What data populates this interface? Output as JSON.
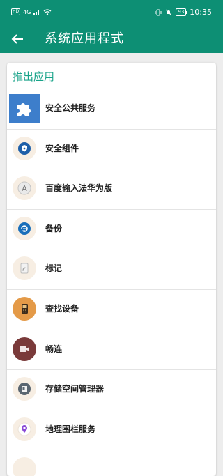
{
  "status": {
    "time": "10:35",
    "battery": "93",
    "hd": "HD",
    "signal": "4G"
  },
  "appbar": {
    "title": "系统应用程式"
  },
  "section": {
    "title": "推出应用"
  },
  "apps": [
    {
      "label": "安全公共服务",
      "icon": "puzzle-icon",
      "color": "#3d7ecb"
    },
    {
      "label": "安全组件",
      "icon": "shield-icon",
      "color": "#1e5fa8"
    },
    {
      "label": "百度输入法华为版",
      "icon": "keyboard-a-icon",
      "color": "#8c8c8c"
    },
    {
      "label": "备份",
      "icon": "backup-icon",
      "color": "#1a6fba"
    },
    {
      "label": "标记",
      "icon": "nfc-tag-icon",
      "color": "#b0b0b0"
    },
    {
      "label": "查找设备",
      "icon": "phone-finder-icon",
      "color": "#e49a48"
    },
    {
      "label": "畅连",
      "icon": "video-call-icon",
      "color": "#7a3a3a"
    },
    {
      "label": "存储空间管理器",
      "icon": "storage-icon",
      "color": "#5a6670"
    },
    {
      "label": "地理围栏服务",
      "icon": "location-pin-icon",
      "color": "#8a4bd6"
    }
  ]
}
